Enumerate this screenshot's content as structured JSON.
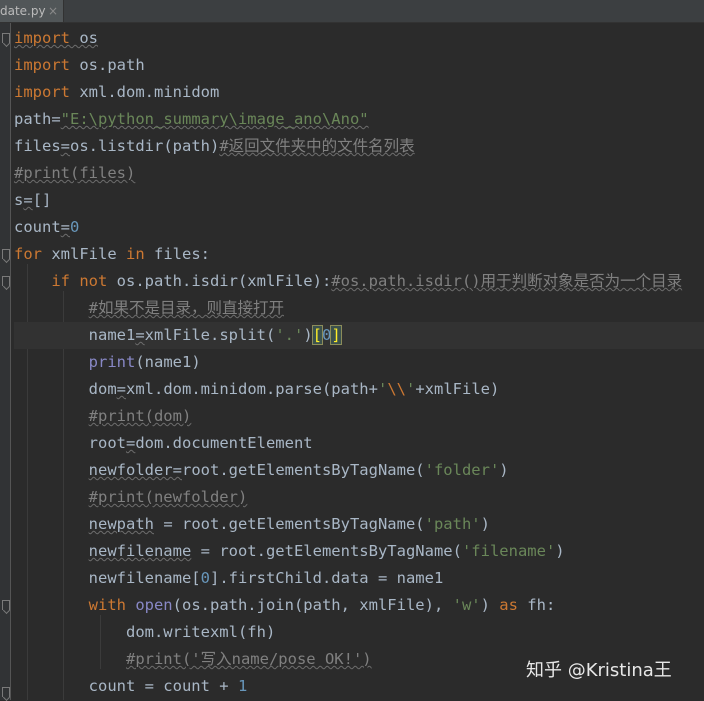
{
  "tab": {
    "filename": "date.py",
    "close": "×"
  },
  "watermark": "知乎 @Kristina王",
  "code": {
    "l1": {
      "kw": "import",
      "rest": " os"
    },
    "l2": {
      "kw": "import",
      "rest": " os.path"
    },
    "l3": {
      "kw": "import",
      "rest": " xml.dom.minidom"
    },
    "l4": {
      "name": "path",
      "op": "=",
      "str": "\"E:\\python_summary\\image_ano\\Ano\""
    },
    "l5": {
      "name": "files",
      "op": "=",
      "rest": "os.listdir(path)",
      "cmt": "#返回文件夹中的文件名列表"
    },
    "l6": {
      "cmt": "#print(files)"
    },
    "l7": {
      "name": "s",
      "op": "=",
      "rest": "[]"
    },
    "l8": {
      "name": "count",
      "op": "=",
      "num": "0"
    },
    "l9": {
      "kw1": "for",
      "mid1": " xmlFile ",
      "kw2": "in",
      "mid2": " files:"
    },
    "l10": {
      "indent": "    ",
      "kw1": "if",
      "kw2": " not",
      "rest": " os.path.isdir(xmlFile):",
      "cmt": "#os.path.isdir()用于判断对象是否为一个目录"
    },
    "l11": {
      "indent": "        ",
      "cmt": "#如果不是目录，则直接打开"
    },
    "l12": {
      "indent": "        ",
      "name": "name1",
      "op": "=",
      "rest": "xmlFile.split(",
      "str": "'.'",
      "close": ")",
      "b1": "[",
      "num": "0",
      "b2": "]"
    },
    "l13": {
      "indent": "        ",
      "fn": "print",
      "rest": "(name1)"
    },
    "l14": {
      "indent": "        ",
      "name": "dom",
      "op": "=",
      "rest": "xml.dom.minidom.parse(path+",
      "q1": "'",
      "esc": "\\\\",
      "q2": "'",
      "rest2": "+xmlFile)"
    },
    "l15": {
      "indent": "        ",
      "cmt": "#print(dom)"
    },
    "l16": {
      "indent": "        ",
      "name": "root",
      "op": "=",
      "rest": "dom.documentElement"
    },
    "l17": {
      "indent": "        ",
      "name": "newfolder",
      "op": "=",
      "rest": "root.getElementsByTagName(",
      "str": "'folder'",
      "close": ")"
    },
    "l18": {
      "indent": "        ",
      "cmt": "#print(newfolder)"
    },
    "l19": {
      "indent": "        ",
      "name": "newpath",
      "op": " = ",
      "rest": "root.getElementsByTagName(",
      "str": "'path'",
      "close": ")"
    },
    "l20": {
      "indent": "        ",
      "name": "newfilename",
      "op": " = ",
      "rest": "root.getElementsByTagName(",
      "str": "'filename'",
      "close": ")"
    },
    "l21": {
      "indent": "        ",
      "rest": "newfilename[",
      "num": "0",
      "rest2": "].firstChild.data = name1"
    },
    "l22": {
      "indent": "        ",
      "kw1": "with",
      "fn": " open",
      "rest": "(os.path.join(path, xmlFile), ",
      "str": "'w'",
      "close": ") ",
      "kw2": "as",
      "rest2": " fh:"
    },
    "l23": {
      "indent": "            ",
      "rest": "dom.writexml(fh)"
    },
    "l24": {
      "indent": "            ",
      "cmt": "#print('写入name/pose OK!')"
    },
    "l25": {
      "indent": "        ",
      "rest": "count = count + ",
      "num": "1"
    }
  }
}
